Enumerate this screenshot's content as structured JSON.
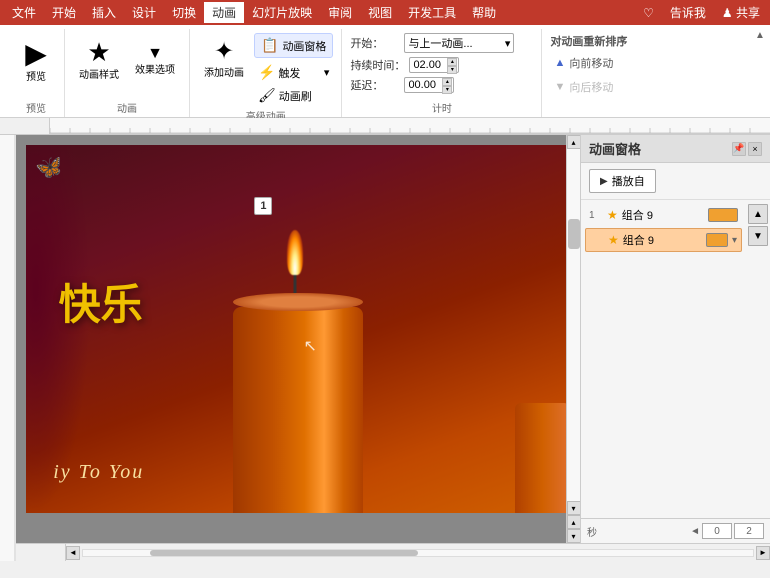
{
  "menubar": {
    "items": [
      "文件",
      "开始",
      "插入",
      "设计",
      "切换",
      "动画",
      "幻灯片放映",
      "审阅",
      "视图",
      "开发工具",
      "帮助"
    ],
    "active": "动画",
    "right_items": [
      "♡",
      "告诉我",
      "♟ 共享"
    ]
  },
  "ribbon": {
    "groups": [
      {
        "name": "preview",
        "label": "预览",
        "buttons": [
          {
            "label": "预览",
            "icon": "▶"
          }
        ]
      },
      {
        "name": "animation",
        "label": "动画",
        "buttons": [
          {
            "label": "动画样式",
            "icon": "★"
          },
          {
            "label": "效果选项",
            "icon": "▼"
          }
        ]
      },
      {
        "name": "advanced-animation",
        "label": "高级动画",
        "buttons": [
          {
            "label": "添加动画",
            "icon": "✦"
          },
          {
            "label": "动画窗格",
            "icon": "📋"
          },
          {
            "label": "触发",
            "icon": "⚡"
          },
          {
            "label": "动画刷",
            "icon": "🖌"
          }
        ]
      },
      {
        "name": "timer",
        "label": "计时",
        "fields": [
          {
            "label": "开始：",
            "value": "与上一动画...",
            "type": "select"
          },
          {
            "label": "持续时间：",
            "value": "02.00",
            "type": "input"
          },
          {
            "label": "延迟：",
            "value": "00.00",
            "type": "input"
          }
        ]
      },
      {
        "name": "reorder",
        "label": "",
        "buttons": [
          {
            "label": "对动画重新排序",
            "type": "heading"
          },
          {
            "label": "向前移动",
            "icon": "▲",
            "enabled": true
          },
          {
            "label": "向后移动",
            "icon": "▼",
            "enabled": false
          }
        ]
      }
    ]
  },
  "slide": {
    "text_kuaile": "快乐",
    "text_birthday": "iy To You",
    "badge_num": "1",
    "candle_color": "#e06000",
    "bg_color": "#6a1020"
  },
  "anim_panel": {
    "title": "动画窗格",
    "play_btn": "播放自",
    "items": [
      {
        "num": "1",
        "star": true,
        "name": "组合 9",
        "color": "#f0a030",
        "selected": false
      },
      {
        "num": "",
        "star": true,
        "name": "组合 9",
        "color": "#f0a030",
        "selected": true
      }
    ],
    "footer": {
      "label": "秒",
      "time_value": "0",
      "time_total": "2"
    },
    "move_up_label": "▲",
    "move_down_label": "▼",
    "close_label": "×",
    "pin_label": "📌"
  },
  "status_bar": {
    "left": "",
    "right": ""
  }
}
